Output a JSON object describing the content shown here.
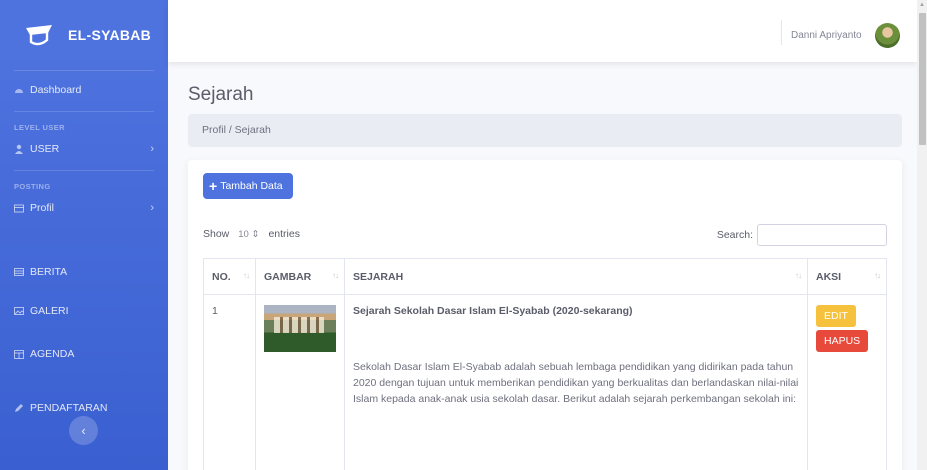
{
  "brand": {
    "name": "EL-SYABAB",
    "logo_icon": "graduation-cap-icon"
  },
  "sidebar": {
    "dashboard": {
      "label": "Dashboard",
      "icon": "dashboard-icon"
    },
    "heading_level_user": "LEVEL USER",
    "user": {
      "label": "USER",
      "icon": "user-icon"
    },
    "heading_posting": "POSTING",
    "profil": {
      "label": "Profil",
      "icon": "folder-icon"
    },
    "berita": {
      "label": "BERITA",
      "icon": "table-icon"
    },
    "galeri": {
      "label": "GALERI",
      "icon": "image-icon"
    },
    "agenda": {
      "label": "AGENDA",
      "icon": "calendar-icon"
    },
    "pendaftaran": {
      "label": "PENDAFTARAN",
      "icon": "pencil-icon"
    },
    "toggle_icon": "chevron-left-icon"
  },
  "topbar": {
    "user_name": "Danni Apriyanto"
  },
  "page": {
    "title": "Sejarah",
    "breadcrumb": "Profil / Sejarah",
    "add_button": "Tambah Data",
    "show_label": "Show",
    "entries_value": "10",
    "entries_label": "entries",
    "search_label": "Search:",
    "search_placeholder": ""
  },
  "table": {
    "headers": [
      "NO.",
      "GAMBAR",
      "SEJARAH",
      "AKSI"
    ],
    "rows": [
      {
        "no": "1",
        "title": "Sejarah Sekolah Dasar Islam El-Syabab (2020-sekarang)",
        "body": "Sekolah Dasar Islam El-Syabab adalah sebuah lembaga pendidikan yang didirikan pada tahun 2020 dengan tujuan untuk memberikan pendidikan yang berkualitas dan berlandaskan nilai-nilai Islam kepada anak-anak usia sekolah dasar. Berikut adalah sejarah perkembangan sekolah ini:",
        "edit_label": "EDIT",
        "delete_label": "HAPUS"
      }
    ]
  },
  "colors": {
    "primary": "#4e73df",
    "warning": "#f6c23e",
    "danger": "#e74a3b"
  }
}
